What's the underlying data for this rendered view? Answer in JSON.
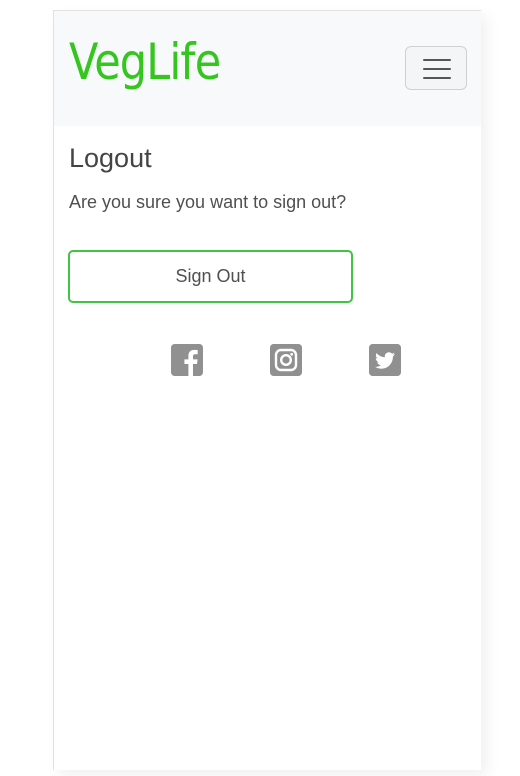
{
  "brand": {
    "name": "VegLife",
    "color": "#34c51f"
  },
  "nav": {
    "toggle_icon": "hamburger-icon"
  },
  "logout": {
    "title": "Logout",
    "message": "Are you sure you want to sign out?",
    "button_label": "Sign Out",
    "button_border_color": "#3fc542"
  },
  "social": {
    "icons": [
      "facebook-icon",
      "instagram-icon",
      "twitter-icon"
    ],
    "color": "#909090"
  }
}
